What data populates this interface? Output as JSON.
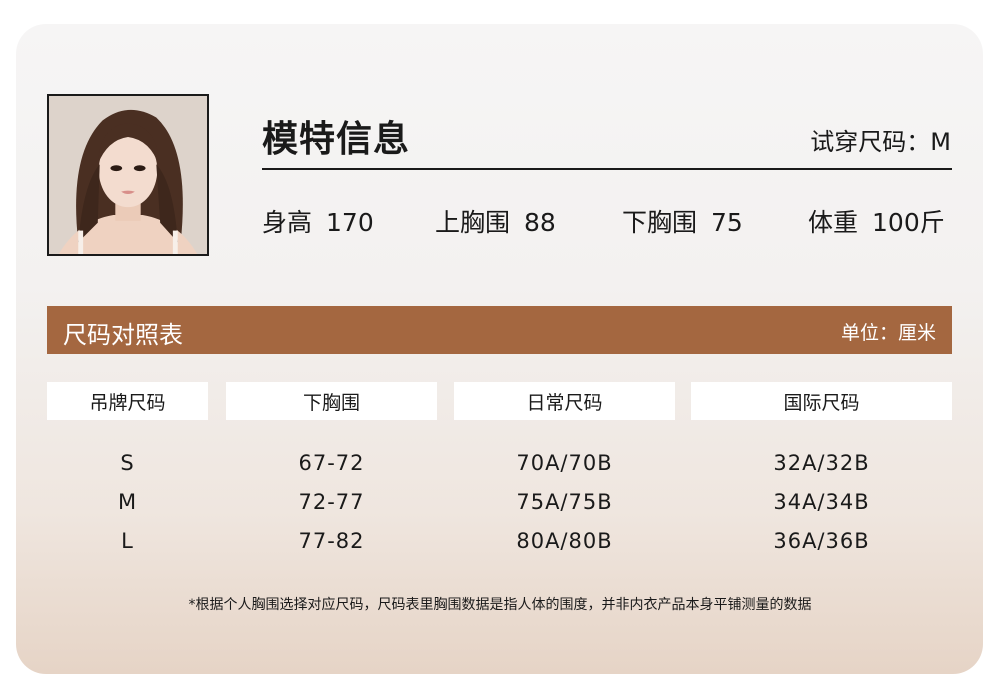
{
  "model": {
    "title": "模特信息",
    "trial_size": "试穿尺码：M",
    "stats": [
      {
        "label": "身高",
        "value": "170"
      },
      {
        "label": "上胸围",
        "value": "88"
      },
      {
        "label": "下胸围",
        "value": "75"
      },
      {
        "label": "体重",
        "value": "100斤"
      }
    ]
  },
  "table": {
    "title": "尺码对照表",
    "unit": "单位：厘米",
    "headers": [
      "吊牌尺码",
      "下胸围",
      "日常尺码",
      "国际尺码"
    ],
    "rows": [
      [
        "S",
        "67-72",
        "70A/70B",
        "32A/32B"
      ],
      [
        "M",
        "72-77",
        "75A/75B",
        "34A/34B"
      ],
      [
        "L",
        "77-82",
        "80A/80B",
        "36A/36B"
      ]
    ]
  },
  "footnote": "*根据个人胸围选择对应尺码，尺码表里胸围数据是指人体的围度，并非内衣产品本身平铺测量的数据",
  "colors": {
    "accent": "#a46740",
    "text": "#1a1a1a",
    "header_cell": "#ffffff"
  }
}
